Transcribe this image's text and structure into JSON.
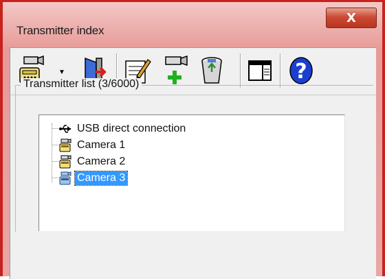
{
  "window": {
    "title": "Transmitter index",
    "close_label": "X"
  },
  "toolbar": {
    "buttons": [
      {
        "name": "transmitter-connect-button",
        "icon": "camera-phone-icon"
      },
      {
        "name": "exit-button",
        "icon": "door-exit-icon"
      },
      {
        "name": "edit-transmitter-button",
        "icon": "edit-notepad-icon"
      },
      {
        "name": "add-transmitter-button",
        "icon": "camera-add-icon"
      },
      {
        "name": "delete-transmitter-button",
        "icon": "recycle-bin-icon"
      },
      {
        "name": "layout-button",
        "icon": "window-layout-icon"
      },
      {
        "name": "help-button",
        "icon": "help-icon"
      }
    ]
  },
  "transmitter_list": {
    "label": "Transmitter list (3/6000)",
    "items": [
      {
        "label": "USB direct connection",
        "icon": "usb-icon",
        "selected": false
      },
      {
        "label": "Camera 1",
        "icon": "camera-icon",
        "selected": false
      },
      {
        "label": "Camera 2",
        "icon": "camera-icon",
        "selected": false
      },
      {
        "label": "Camera 3",
        "icon": "camera-icon",
        "selected": true
      }
    ]
  },
  "colors": {
    "frame": "#c8211e",
    "selection": "#3399ff",
    "help": "#1a3fd0"
  }
}
